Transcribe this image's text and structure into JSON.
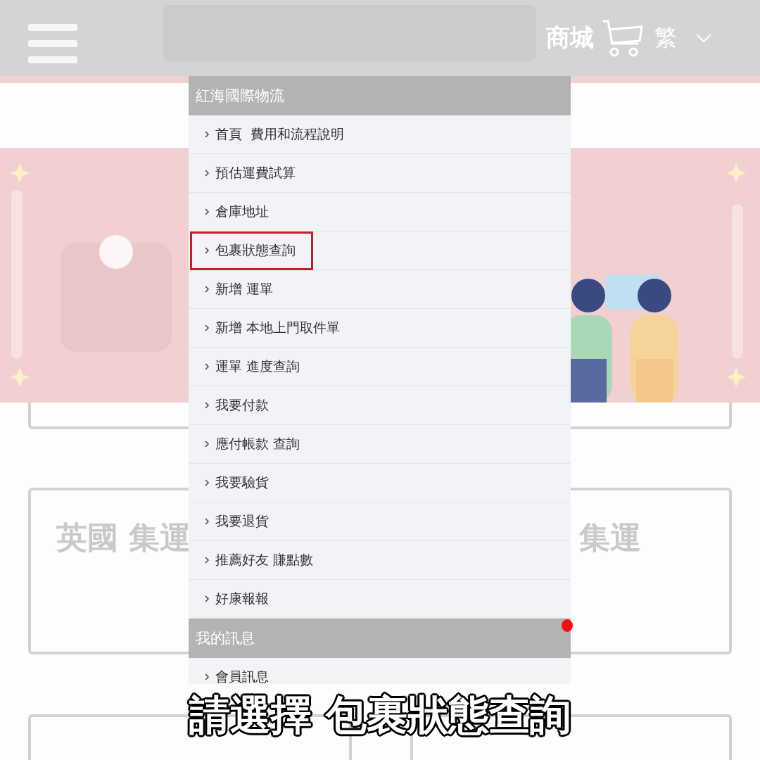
{
  "header": {
    "mall_label": "商城",
    "language": "繁"
  },
  "menu": {
    "sections": [
      {
        "title": "紅海國際物流",
        "items": [
          {
            "label": "首頁  費用和流程說明",
            "highlighted": false
          },
          {
            "label": "預估運費試算",
            "highlighted": false
          },
          {
            "label": "倉庫地址",
            "highlighted": false
          },
          {
            "label": "包裹狀態查詢",
            "highlighted": true
          },
          {
            "label": "新增 運單",
            "highlighted": false
          },
          {
            "label": "新增 本地上門取件單",
            "highlighted": false
          },
          {
            "label": "運單 進度查詢",
            "highlighted": false
          },
          {
            "label": "我要付款",
            "highlighted": false
          },
          {
            "label": "應付帳款 查詢",
            "highlighted": false
          },
          {
            "label": "我要驗貨",
            "highlighted": false
          },
          {
            "label": "我要退貨",
            "highlighted": false
          },
          {
            "label": "推薦好友 賺點數",
            "highlighted": false
          },
          {
            "label": "好康報報",
            "highlighted": false
          }
        ]
      },
      {
        "title": "我的訊息",
        "items": [
          {
            "label": "會員訊息",
            "highlighted": false
          }
        ]
      }
    ]
  },
  "cards": [
    {
      "title": "英國 集運"
    },
    {
      "title": "集運"
    }
  ],
  "caption": "請選擇 包裹狀態查詢"
}
